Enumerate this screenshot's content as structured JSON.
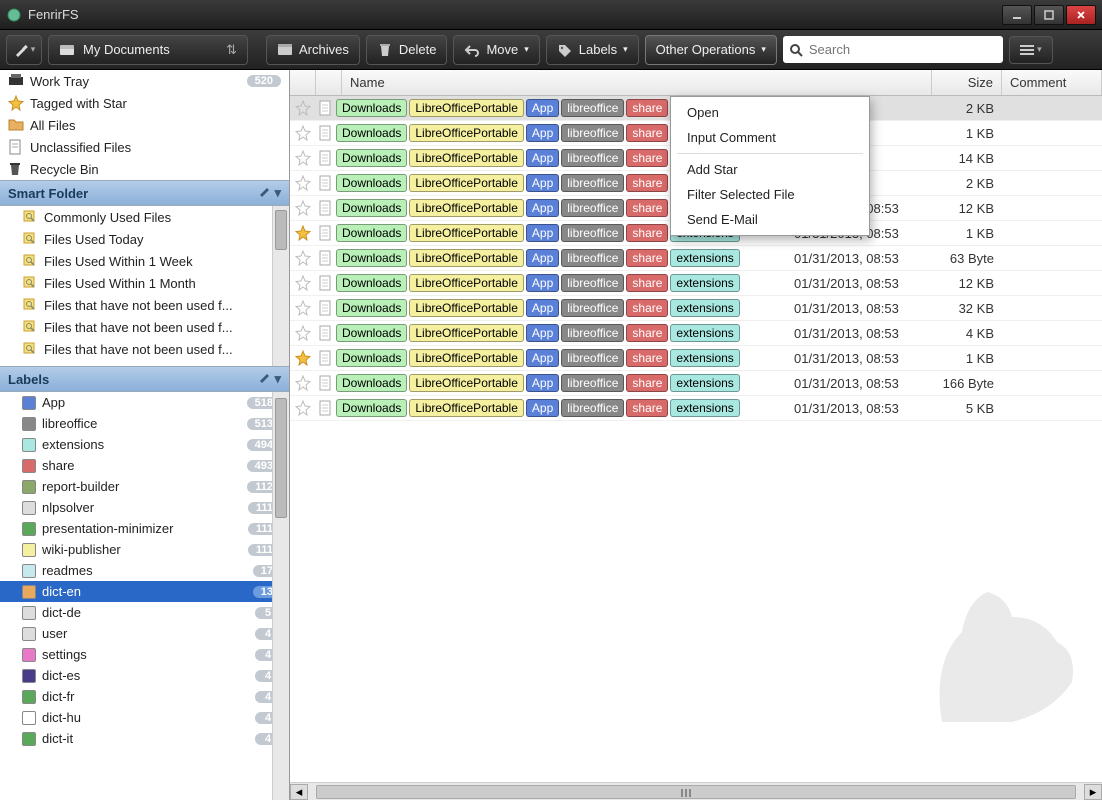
{
  "app": {
    "title": "FenrirFS"
  },
  "toolbar": {
    "location": "My Documents",
    "archives": "Archives",
    "delete": "Delete",
    "move": "Move",
    "labels": "Labels",
    "other": "Other Operations",
    "search_placeholder": "Search"
  },
  "sidebar": {
    "fixed": [
      {
        "icon": "tray",
        "label": "Work Tray",
        "badge": "520"
      },
      {
        "icon": "star",
        "label": "Tagged with Star",
        "badge": ""
      },
      {
        "icon": "folder",
        "label": "All Files",
        "badge": ""
      },
      {
        "icon": "doc",
        "label": "Unclassified Files",
        "badge": ""
      },
      {
        "icon": "trash",
        "label": "Recycle Bin",
        "badge": ""
      }
    ],
    "smart_header": "Smart Folder",
    "smart": [
      {
        "label": "Commonly Used Files"
      },
      {
        "label": "Files Used Today"
      },
      {
        "label": "Files Used Within 1 Week"
      },
      {
        "label": "Files Used Within 1 Month"
      },
      {
        "label": "Files that have not been used f..."
      },
      {
        "label": "Files that have not been used f..."
      },
      {
        "label": "Files that have not been used f..."
      }
    ],
    "labels_header": "Labels",
    "labels": [
      {
        "color": "#5a80d8",
        "name": "App",
        "count": "518"
      },
      {
        "color": "#888888",
        "name": "libreoffice",
        "count": "513"
      },
      {
        "color": "#a8e8e0",
        "name": "extensions",
        "count": "494"
      },
      {
        "color": "#d96a6a",
        "name": "share",
        "count": "493"
      },
      {
        "color": "#8aa86a",
        "name": "report-builder",
        "count": "112"
      },
      {
        "color": "#dddddd",
        "name": "nlpsolver",
        "count": "111"
      },
      {
        "color": "#5aa85a",
        "name": "presentation-minimizer",
        "count": "111"
      },
      {
        "color": "#f5f0a0",
        "name": "wiki-publisher",
        "count": "111"
      },
      {
        "color": "#c8e8f0",
        "name": "readmes",
        "count": "17"
      },
      {
        "color": "#e8a860",
        "name": "dict-en",
        "count": "13",
        "selected": true
      },
      {
        "color": "#dddddd",
        "name": "dict-de",
        "count": "5"
      },
      {
        "color": "#dddddd",
        "name": "user",
        "count": "4"
      },
      {
        "color": "#e878c8",
        "name": "settings",
        "count": "4"
      },
      {
        "color": "#4a3a8a",
        "name": "dict-es",
        "count": "4"
      },
      {
        "color": "#5aa85a",
        "name": "dict-fr",
        "count": "4"
      },
      {
        "color": "#ffffff",
        "name": "dict-hu",
        "count": "4"
      },
      {
        "color": "#5aa85a",
        "name": "dict-it",
        "count": "4"
      }
    ]
  },
  "columns": {
    "name": "Name",
    "size": "Size",
    "comment": "Comment"
  },
  "tags_common": [
    "Downloads",
    "LibreOfficePortable",
    "App",
    "libreoffice",
    "share",
    "extensions"
  ],
  "rows": [
    {
      "star": false,
      "date": "",
      "size": "2 KB",
      "selected": true
    },
    {
      "star": false,
      "date": "",
      "size": "1 KB"
    },
    {
      "star": false,
      "date": "",
      "size": "14 KB"
    },
    {
      "star": false,
      "date": "",
      "size": "2 KB"
    },
    {
      "star": false,
      "date": "01/31/2013, 08:53",
      "size": "12 KB"
    },
    {
      "star": true,
      "date": "01/31/2013, 08:53",
      "size": "1 KB"
    },
    {
      "star": false,
      "date": "01/31/2013, 08:53",
      "size": "63 Byte"
    },
    {
      "star": false,
      "date": "01/31/2013, 08:53",
      "size": "12 KB"
    },
    {
      "star": false,
      "date": "01/31/2013, 08:53",
      "size": "32 KB"
    },
    {
      "star": false,
      "date": "01/31/2013, 08:53",
      "size": "4 KB"
    },
    {
      "star": true,
      "date": "01/31/2013, 08:53",
      "size": "1 KB"
    },
    {
      "star": false,
      "date": "01/31/2013, 08:53",
      "size": "166 Byte"
    },
    {
      "star": false,
      "date": "01/31/2013, 08:53",
      "size": "5 KB"
    }
  ],
  "ctxmenu": {
    "open": "Open",
    "input_comment": "Input Comment",
    "add_star": "Add Star",
    "filter": "Filter Selected File",
    "email": "Send E-Mail"
  }
}
